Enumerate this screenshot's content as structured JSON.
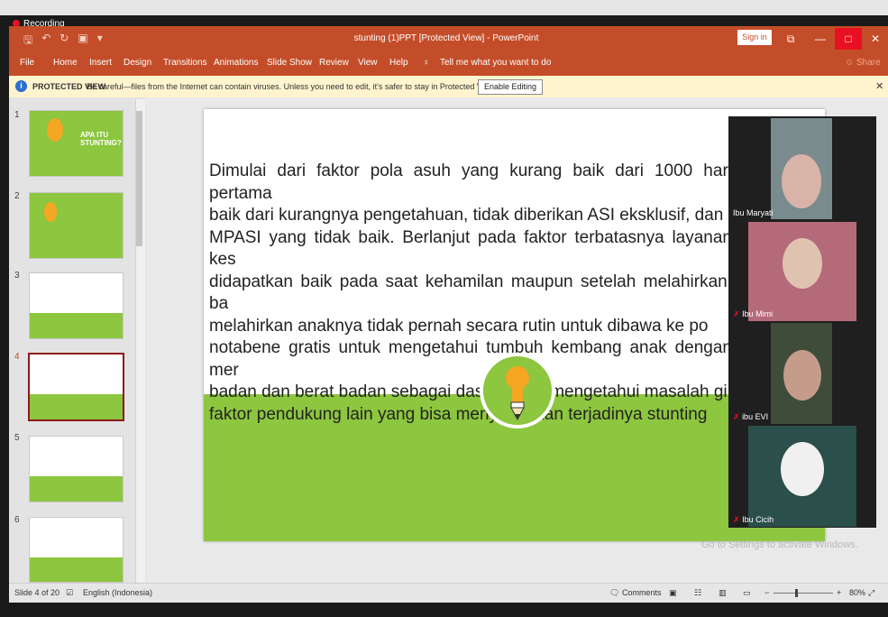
{
  "recording": {
    "label": "Recording"
  },
  "window": {
    "title": "stunting (1)PPT [Protected View] - PowerPoint",
    "sign_in": "Sign in",
    "share": "Share"
  },
  "ribbon": {
    "tabs": [
      "File",
      "Home",
      "Insert",
      "Design",
      "Transitions",
      "Animations",
      "Slide Show",
      "Review",
      "View",
      "Help"
    ],
    "tell_me": "Tell me what you want to do"
  },
  "protected_view": {
    "title": "PROTECTED VIEW",
    "message": "Be careful—files from the Internet can contain viruses. Unless you need to edit, it's safer to stay in Protected View.",
    "button": "Enable Editing"
  },
  "thumbnails": {
    "numbers": [
      "1",
      "2",
      "3",
      "4",
      "5",
      "6"
    ],
    "slide1_title": "APA ITU STUNTING?"
  },
  "slide": {
    "text_lines": [
      "Dimulai dari faktor pola asuh yang kurang baik dari 1000 hari pertama",
      "baik dari kurangnya pengetahuan, tidak diberikan ASI eksklusif, dan",
      "MPASI yang tidak baik. Berlanjut pada faktor terbatasnya layanan kes",
      "didapatkan baik pada saat kehamilan maupun setelah melahirkan. ba",
      "melahirkan anaknya tidak pernah  secara rutin untuk dibawa ke po",
      "notabene gratis untuk mengetahui tumbuh kembang anak dengan mer",
      "badan dan berat badan sebagai dasar untuk mengetahui masalah gi",
      "faktor pendukung lain yang bisa menyebabkan terjadinya stunting"
    ]
  },
  "participants": [
    {
      "name": "Ibu Maryati",
      "bg": "#7a8b8e"
    },
    {
      "name": "Ibu Mimi",
      "bg": "#b56a79"
    },
    {
      "name": "ibu EVI",
      "bg": "#3f4c3a"
    },
    {
      "name": "Ibu Cicih",
      "bg": "#2b4f4a"
    }
  ],
  "watermark": "Go to Settings to activate Windows.",
  "status": {
    "slide_info": "Slide 4 of 20",
    "language": "English (Indonesia)",
    "comments": "Comments",
    "zoom": "80%"
  },
  "colors": {
    "accent": "#c44d29",
    "slide_green": "#8dc63f",
    "bulb_orange": "#f5a623"
  }
}
